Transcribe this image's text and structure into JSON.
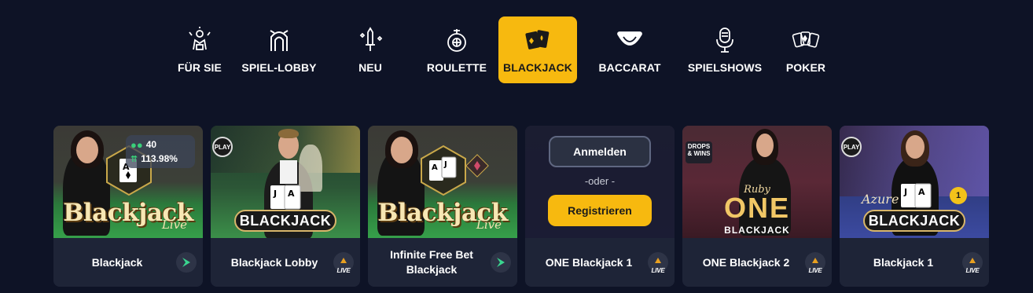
{
  "nav": {
    "items": [
      {
        "label": "FÜR SIE",
        "icon": "for-you-icon"
      },
      {
        "label": "SPIEL-LOBBY",
        "icon": "lobby-arch-icon"
      },
      {
        "label": "NEU",
        "icon": "sword-sparkle-icon"
      },
      {
        "label": "ROULETTE",
        "icon": "roulette-icon"
      },
      {
        "label": "BLACKJACK",
        "icon": "cards-icon",
        "active": true
      },
      {
        "label": "BACCARAT",
        "icon": "baccarat-table-icon"
      },
      {
        "label": "SPIELSHOWS",
        "icon": "microphone-icon"
      },
      {
        "label": "POKER",
        "icon": "poker-cards-icon"
      }
    ]
  },
  "cards": [
    {
      "title": "Blackjack",
      "provider": "green-provider-icon",
      "logo_text": "Blackjack",
      "logo_sub": "Live",
      "stats": {
        "players": "40",
        "rtp": "113.98%"
      }
    },
    {
      "title": "Blackjack Lobby",
      "provider": "live-provider-icon",
      "provider_text": "LIVE",
      "badge": "PLAY",
      "plate_text": "BLACKJACK"
    },
    {
      "title": "Infinite Free Bet Blackjack",
      "provider": "green-provider-icon",
      "logo_text": "Blackjack",
      "logo_sub": "Live"
    },
    {
      "title": "ONE Blackjack 1",
      "provider": "live-provider-icon",
      "provider_text": "LIVE",
      "login": {
        "login_label": "Anmelden",
        "or_label": "-oder -",
        "register_label": "Registrieren"
      }
    },
    {
      "title": "ONE Blackjack 2",
      "provider": "live-provider-icon",
      "provider_text": "LIVE",
      "badge": "DROPS & WINS",
      "brand_top": "Ruby",
      "brand_main": "ONE",
      "brand_sub": "BLACKJACK"
    },
    {
      "title": "Blackjack 1",
      "provider": "live-provider-icon",
      "provider_text": "LIVE",
      "badge": "PLAY",
      "brand_top": "Azure",
      "plate_text": "BLACKJACK"
    }
  ],
  "colors": {
    "background": "#0e1326",
    "accent": "#f7b90f",
    "card_footer": "#1e2437"
  }
}
